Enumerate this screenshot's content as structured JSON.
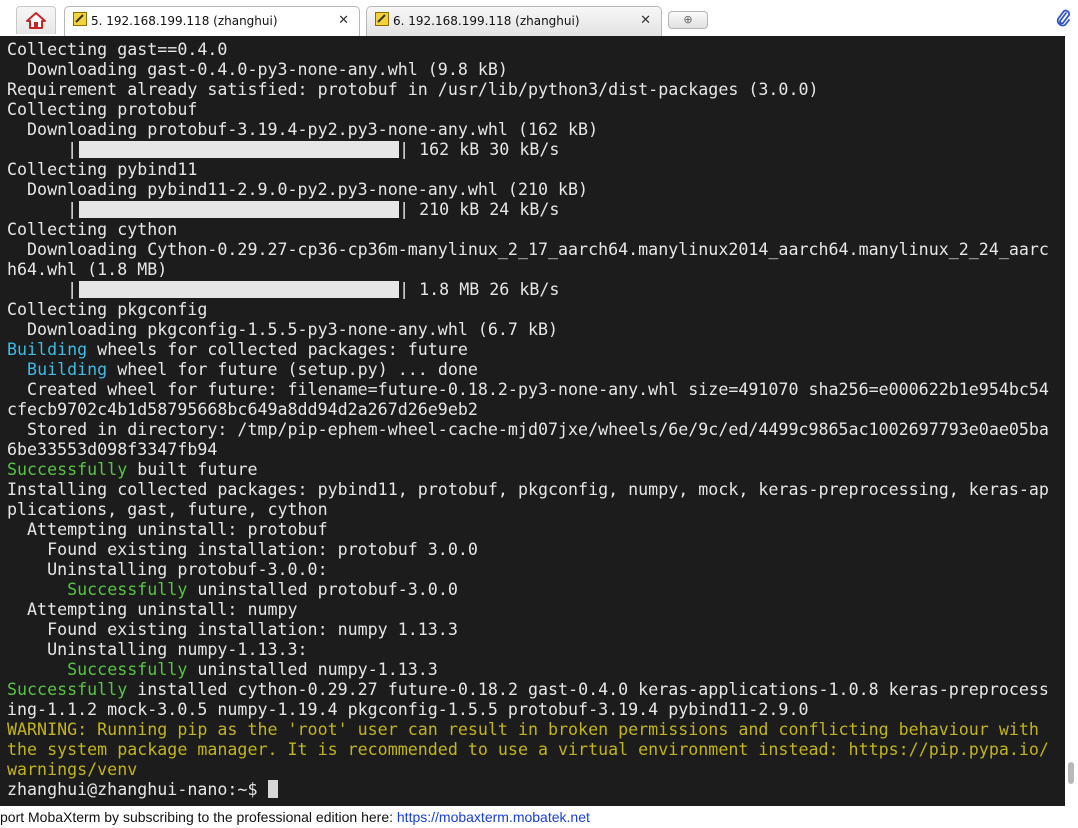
{
  "tabs": [
    {
      "label": "5. 192.168.199.118 (zhanghui)",
      "close": "✕"
    },
    {
      "label": "6. 192.168.199.118 (zhanghui)",
      "close": "✕"
    }
  ],
  "newtab": {
    "label": "⊕"
  },
  "icons": {
    "home": "home-icon",
    "terminal": "terminal-session-icon",
    "paperclip": "paperclip-icon"
  },
  "colors": {
    "background": "#1c1c1c",
    "text": "#e6e6e6",
    "cyan": "#3cbce6",
    "green": "#56c640",
    "yellow": "#c2b41a"
  },
  "terminal": {
    "lines": [
      {
        "parts": [
          {
            "t": "Collecting gast==0.4.0"
          }
        ]
      },
      {
        "parts": [
          {
            "t": "  Downloading gast-0.4.0-py3-none-any.whl (9.8 kB)"
          }
        ]
      },
      {
        "parts": [
          {
            "t": "Requirement already satisfied: protobuf in /usr/lib/python3/dist-packages (3.0.0)"
          }
        ]
      },
      {
        "parts": [
          {
            "t": "Collecting protobuf"
          }
        ]
      },
      {
        "parts": [
          {
            "t": "  Downloading protobuf-3.19.4-py2.py3-none-any.whl (162 kB)"
          }
        ]
      },
      {
        "progress": 1.0,
        "parts": [
          {
            "t": "| 162 kB 30 kB/s"
          }
        ]
      },
      {
        "parts": [
          {
            "t": "Collecting pybind11"
          }
        ]
      },
      {
        "parts": [
          {
            "t": "  Downloading pybind11-2.9.0-py2.py3-none-any.whl (210 kB)"
          }
        ]
      },
      {
        "progress": 1.0,
        "parts": [
          {
            "t": "| 210 kB 24 kB/s"
          }
        ]
      },
      {
        "parts": [
          {
            "t": "Collecting cython"
          }
        ]
      },
      {
        "parts": [
          {
            "t": "  Downloading Cython-0.29.27-cp36-cp36m-manylinux_2_17_aarch64.manylinux2014_aarch64.manylinux_2_24_aarc"
          }
        ]
      },
      {
        "parts": [
          {
            "t": "h64.whl (1.8 MB)"
          }
        ]
      },
      {
        "progress": 1.0,
        "parts": [
          {
            "t": "| 1.8 MB 26 kB/s"
          }
        ]
      },
      {
        "parts": [
          {
            "t": "Collecting pkgconfig"
          }
        ]
      },
      {
        "parts": [
          {
            "t": "  Downloading pkgconfig-1.5.5-py3-none-any.whl (6.7 kB)"
          }
        ]
      },
      {
        "parts": [
          {
            "t": "Building",
            "c": "cyan"
          },
          {
            "t": " wheels for collected packages: future"
          }
        ]
      },
      {
        "parts": [
          {
            "t": "  "
          },
          {
            "t": "Building",
            "c": "cyan"
          },
          {
            "t": " wheel for future (setup.py) ... done"
          }
        ]
      },
      {
        "parts": [
          {
            "t": "  Created wheel for future: filename=future-0.18.2-py3-none-any.whl size=491070 sha256=e000622b1e954bc54"
          }
        ]
      },
      {
        "parts": [
          {
            "t": "cfecb9702c4b1d58795668bc649a8dd94d2a267d26e9eb2"
          }
        ]
      },
      {
        "parts": [
          {
            "t": "  Stored in directory: /tmp/pip-ephem-wheel-cache-mjd07jxe/wheels/6e/9c/ed/4499c9865ac1002697793e0ae05ba"
          }
        ]
      },
      {
        "parts": [
          {
            "t": "6be33553d098f3347fb94"
          }
        ]
      },
      {
        "parts": [
          {
            "t": "Successfully",
            "c": "green"
          },
          {
            "t": " built future"
          }
        ]
      },
      {
        "parts": [
          {
            "t": "Installing collected packages: pybind11, protobuf, pkgconfig, numpy, mock, keras-preprocessing, keras-ap"
          }
        ]
      },
      {
        "parts": [
          {
            "t": "plications, gast, future, cython"
          }
        ]
      },
      {
        "parts": [
          {
            "t": "  Attempting uninstall: protobuf"
          }
        ]
      },
      {
        "parts": [
          {
            "t": "    Found existing installation: protobuf 3.0.0"
          }
        ]
      },
      {
        "parts": [
          {
            "t": "    Uninstalling protobuf-3.0.0:"
          }
        ]
      },
      {
        "parts": [
          {
            "t": "      "
          },
          {
            "t": "Successfully",
            "c": "green"
          },
          {
            "t": " uninstalled protobuf-3.0.0"
          }
        ]
      },
      {
        "parts": [
          {
            "t": "  Attempting uninstall: numpy"
          }
        ]
      },
      {
        "parts": [
          {
            "t": "    Found existing installation: numpy 1.13.3"
          }
        ]
      },
      {
        "parts": [
          {
            "t": "    Uninstalling numpy-1.13.3:"
          }
        ]
      },
      {
        "parts": [
          {
            "t": "      "
          },
          {
            "t": "Successfully",
            "c": "green"
          },
          {
            "t": " uninstalled numpy-1.13.3"
          }
        ]
      },
      {
        "parts": [
          {
            "t": "Successfully",
            "c": "green"
          },
          {
            "t": " installed cython-0.29.27 future-0.18.2 gast-0.4.0 keras-applications-1.0.8 keras-preprocess"
          }
        ]
      },
      {
        "parts": [
          {
            "t": "ing-1.1.2 mock-3.0.5 numpy-1.19.4 pkgconfig-1.5.5 protobuf-3.19.4 pybind11-2.9.0"
          }
        ]
      },
      {
        "parts": [
          {
            "t": "WARNING: Running pip as the 'root' user can result in broken permissions and conflicting behaviour with",
            "c": "yellow"
          }
        ]
      },
      {
        "parts": [
          {
            "t": "the system package manager. It is recommended to use a virtual environment instead: https://pip.pypa.io/",
            "c": "yellow"
          }
        ]
      },
      {
        "parts": [
          {
            "t": "warnings/venv",
            "c": "yellow"
          }
        ]
      },
      {
        "prompt": true,
        "parts": [
          {
            "t": "zhanghui@zhanghui-nano:~$ "
          }
        ]
      }
    ]
  },
  "statusbar": {
    "text": "port MobaXterm by subscribing to the professional edition here:  ",
    "link": "https://mobaxterm.mobatek.net"
  }
}
